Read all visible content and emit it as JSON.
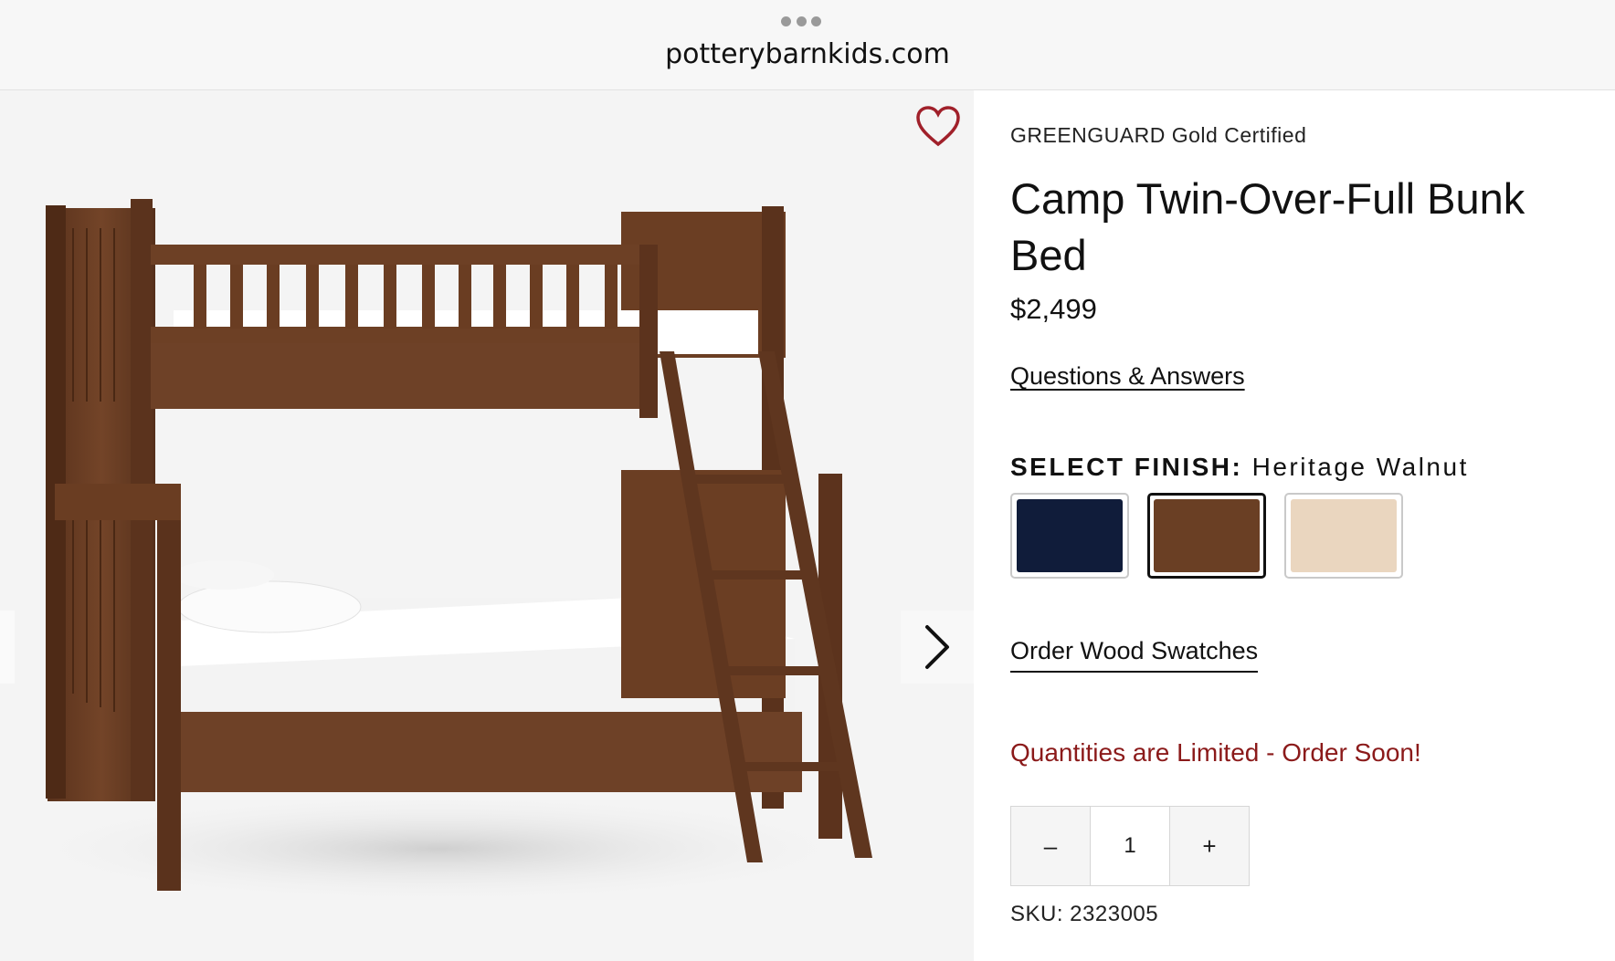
{
  "browser": {
    "url": "potterybarnkids.com",
    "menu_icon": "ellipsis-icon"
  },
  "gallery": {
    "image_alt": "Camp Twin-Over-Full Bunk Bed",
    "favorite_icon": "heart-icon",
    "next_icon": "chevron-right-icon"
  },
  "product": {
    "badge": "GREENGUARD Gold Certified",
    "title": "Camp Twin-Over-Full Bunk Bed",
    "price": "$2,499",
    "qa_link": "Questions & Answers",
    "finish_label": "SELECT FINISH:",
    "finish_selected": "Heritage Walnut",
    "swatches": [
      {
        "color": "#101c3a",
        "selected": false
      },
      {
        "color": "#6a3f24",
        "selected": true
      },
      {
        "color": "#ead6bf",
        "selected": false
      }
    ],
    "order_swatches_link": "Order Wood Swatches",
    "limited_notice": "Quantities are Limited - Order Soon!",
    "quantity": {
      "minus": "–",
      "value": "1",
      "plus": "+"
    },
    "sku": "SKU: 2323005"
  },
  "colors": {
    "accent_red": "#8b1a1a",
    "heart": "#a0202a",
    "wood": "#6a3f24"
  }
}
